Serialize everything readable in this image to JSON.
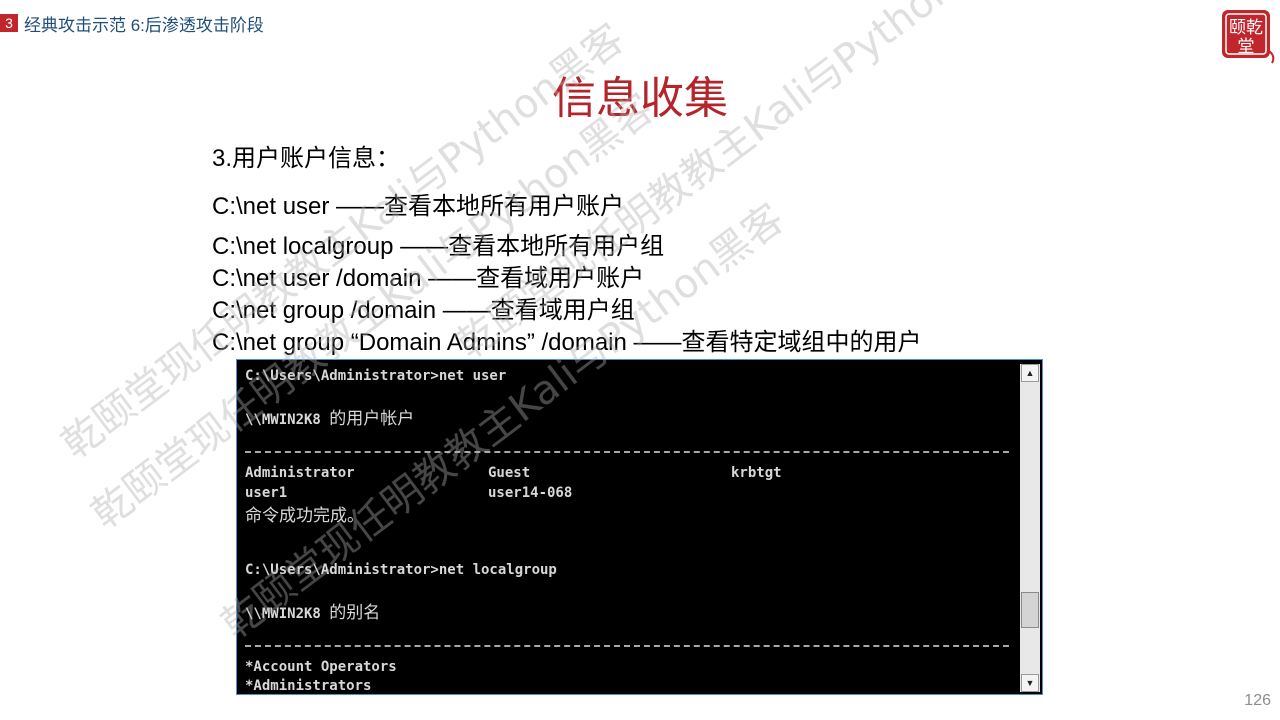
{
  "header": {
    "section_number": "3",
    "section_title": "经典攻击示范 6:后渗透攻击阶段"
  },
  "logo": {
    "text_top": "颐乾",
    "text_bottom": "堂",
    "color": "#c0262c"
  },
  "title": "信息收集",
  "body": {
    "subheading": "3.用户账户信息：",
    "commands": [
      "C:\\net user ——查看本地所有用户账户",
      "C:\\net localgroup ——查看本地所有用户组",
      "C:\\net user /domain ——查看域用户账户",
      "C:\\net group /domain ——查看域用户组",
      "C:\\net group “Domain Admins” /domain ——查看特定域组中的用户"
    ]
  },
  "watermark_text": "乾颐堂现任明教教主Kali与Python黑客",
  "terminal": {
    "prompt1": "C:\\Users\\Administrator>net user",
    "users_header_host": "\\\\MWIN2K8 ",
    "users_header_label": "的用户帐户",
    "users_row1": [
      "Administrator",
      "Guest",
      "krbtgt"
    ],
    "users_row2": [
      "user1",
      "user14-068"
    ],
    "success": "命令成功完成。",
    "prompt2": "C:\\Users\\Administrator>net localgroup",
    "alias_header_host": "\\\\MWIN2K8 ",
    "alias_header_label": "的别名",
    "groups": [
      "*Account Operators",
      "*Administrators"
    ]
  },
  "scrollbar": {
    "up_icon": "▲",
    "down_icon": "▼"
  },
  "page_number": "126",
  "colors": {
    "title": "#b3242b",
    "badge": "#c0262c",
    "header_text": "#1f4e79",
    "terminal_bg": "#000000"
  }
}
